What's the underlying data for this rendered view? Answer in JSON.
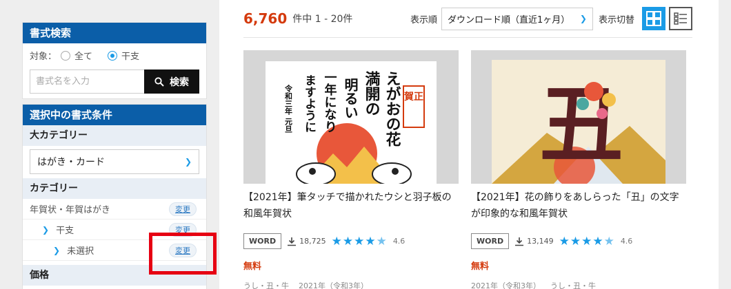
{
  "search": {
    "title": "書式検索",
    "target_label": "対象：",
    "options": [
      "全て",
      "干支"
    ],
    "selected": "干支",
    "placeholder": "書式名を入力",
    "button_label": "検索"
  },
  "conditions": {
    "title": "選択中の書式条件",
    "major_category_label": "大カテゴリー",
    "major_category_value": "はがき・カード",
    "category_label": "カテゴリー",
    "rows": [
      {
        "label": "年賀状・年賀はがき",
        "change": "変更"
      },
      {
        "label": "干支",
        "change": "変更"
      },
      {
        "label": "未選択",
        "change": "変更"
      }
    ],
    "price_label": "価格"
  },
  "results": {
    "count": "6,760",
    "range_text": "件中 1 - 20件",
    "sort_label": "表示順",
    "sort_value": "ダウンロード順（直近1ヶ月）",
    "view_label": "表示切替"
  },
  "cards": [
    {
      "title": "【2021年】筆タッチで描かれたウシと羽子板の和風年賀状",
      "thumb_text": [
        "えがおの花",
        "満開の",
        "明るい",
        "一年になり",
        "ますように",
        "令和三年 元旦",
        "賀正"
      ],
      "format": "WORD",
      "downloads": "18,725",
      "rating": 4.6,
      "rating_label": "4.6",
      "price": "無料",
      "tags": [
        "うし・丑・牛",
        "2021年（令和3年）"
      ]
    },
    {
      "title": "【2021年】花の飾りをあしらった「丑」の文字が印象的な和風年賀状",
      "thumb_text": [
        "丑"
      ],
      "format": "WORD",
      "downloads": "13,149",
      "rating": 4.6,
      "rating_label": "4.6",
      "price": "無料",
      "tags": [
        "2021年（令和3年）",
        "うし・丑・牛"
      ]
    }
  ],
  "colors": {
    "header_blue": "#0b5ea8",
    "accent_blue": "#1a9be6",
    "count_red": "#d43a0d",
    "highlight_red": "#e60012"
  }
}
